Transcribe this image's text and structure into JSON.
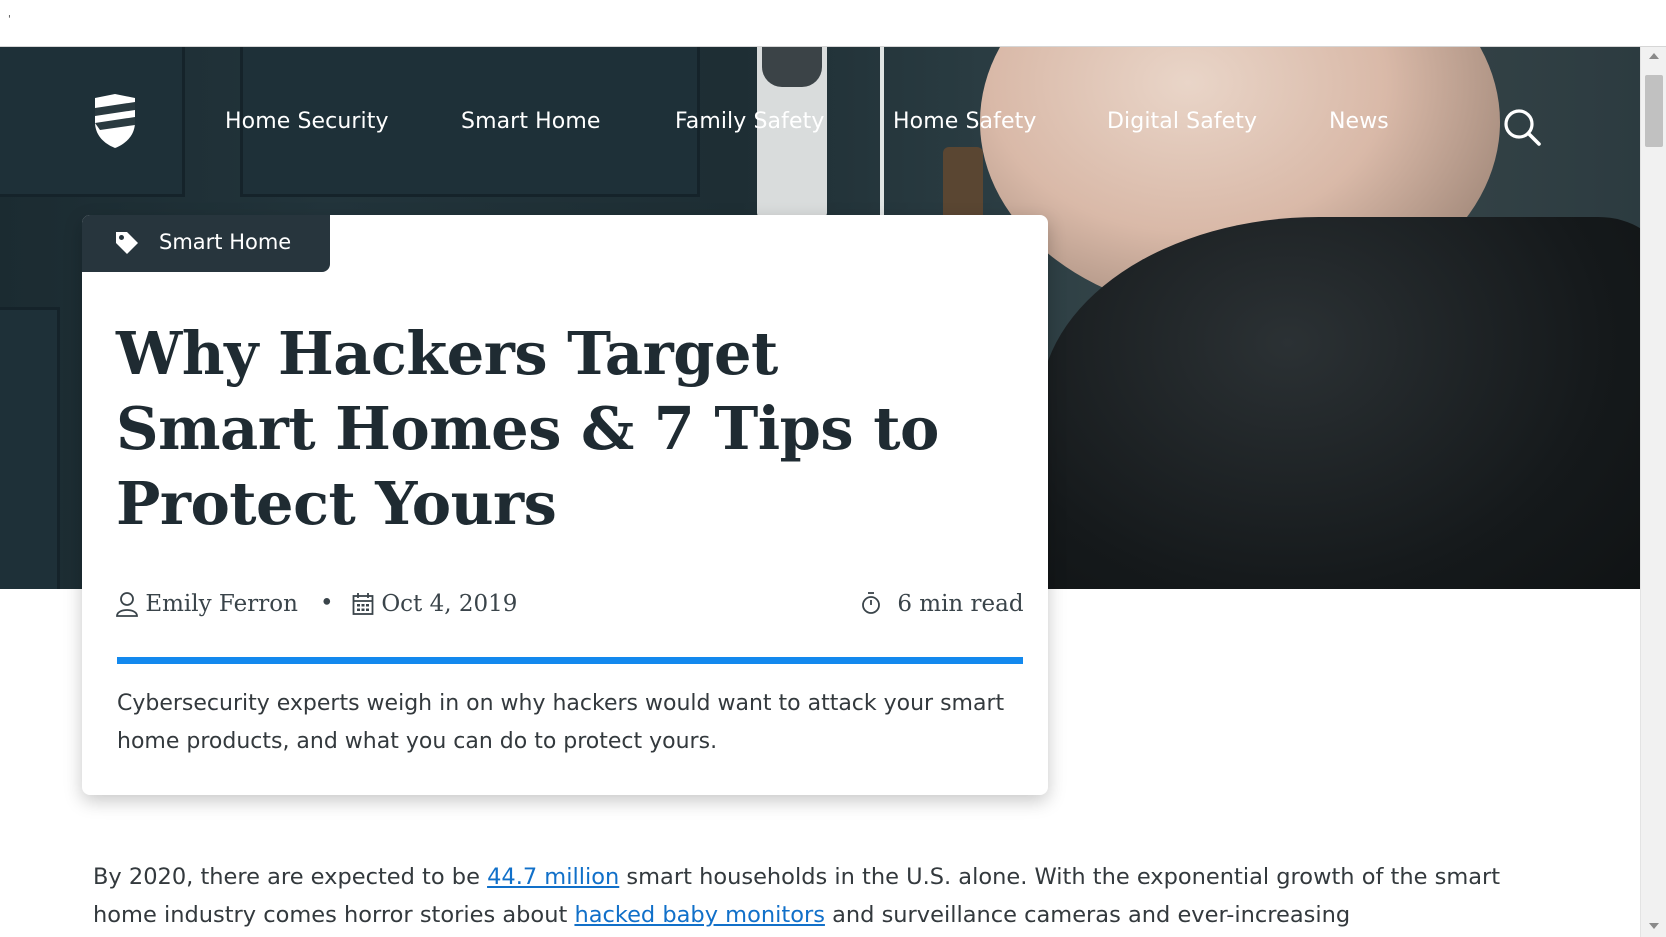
{
  "nav": {
    "links": [
      "Home Security",
      "Smart Home",
      "Family Safety",
      "Home Safety",
      "Digital Safety",
      "News"
    ],
    "logo_icon": "shield-logo-icon",
    "search_icon": "search-icon"
  },
  "article": {
    "category": "Smart Home",
    "category_icon": "tag-icon",
    "title": "Why Hackers Target Smart Homes & 7 Tips to Protect Yours",
    "author": "Emily Ferron",
    "separator": "•",
    "date": "Oct 4, 2019",
    "read_time": "6 min read",
    "progress_fraction": 1.0,
    "summary": "Cybersecurity experts weigh in on why hackers would want to attack your smart home products, and what you can do to protect yours.",
    "body": {
      "p1_a": "By 2020, there are expected to be ",
      "link1": "44.7 million",
      "p1_b": " smart households in the U.S. alone. With the exponential growth of the smart home industry comes horror stories about ",
      "link2": "hacked baby monitors",
      "p1_c": " and surveillance cameras and ever-increasing"
    }
  },
  "colors": {
    "accent": "#1389ee",
    "link": "#1170c9",
    "title_text": "#1f2b32",
    "tag_bg": "#27353d"
  },
  "topbar": {
    "mark": "'"
  }
}
